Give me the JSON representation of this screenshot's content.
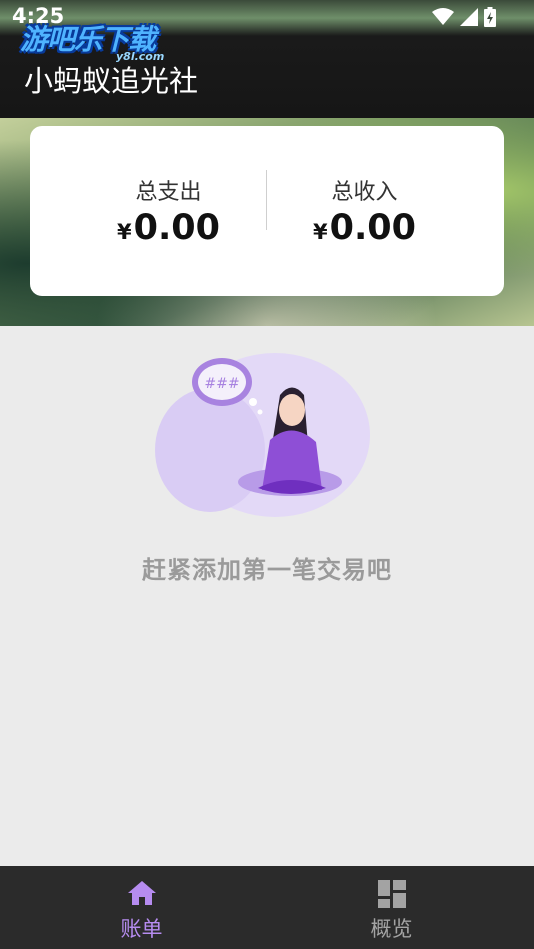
{
  "status_bar": {
    "time": "4:25"
  },
  "watermark": {
    "brand": "游吧乐下载",
    "domain": "y8l.com"
  },
  "app_bar": {
    "title": "小蚂蚁追光社"
  },
  "summary": {
    "expense": {
      "label": "总支出",
      "currency": "¥",
      "amount": "0.00"
    },
    "income": {
      "label": "总收入",
      "currency": "¥",
      "amount": "0.00"
    }
  },
  "empty_state": {
    "message": "赶紧添加第一笔交易吧"
  },
  "bottom_nav": {
    "items": [
      {
        "label": "账单",
        "icon": "home-icon",
        "active": true
      },
      {
        "label": "概览",
        "icon": "dashboard-icon",
        "active": false
      }
    ],
    "active_color": "#b68cf0",
    "inactive_color": "#a3a3a3"
  },
  "colors": {
    "accent_purple": "#b68cf0",
    "illustration_purple": "#c9b6ee"
  }
}
